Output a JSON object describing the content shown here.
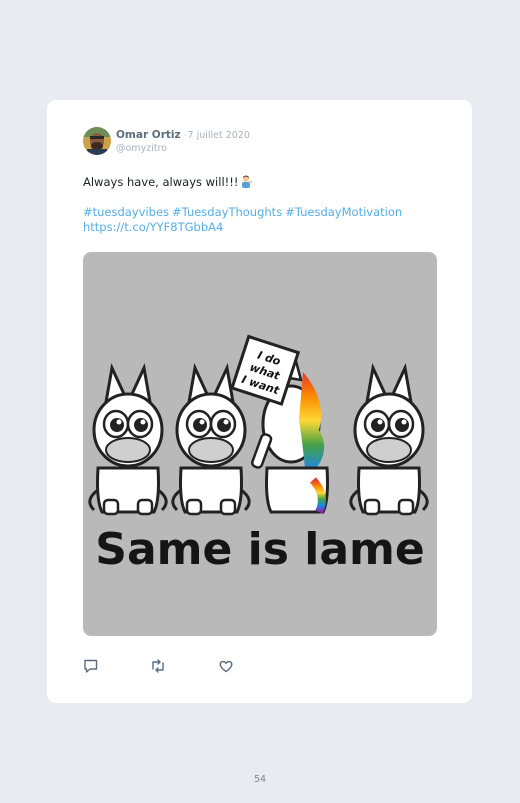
{
  "tweet": {
    "author_name": "Omar Ortiz",
    "separator": "·",
    "date": "7 juillet 2020",
    "handle": "@omyzitro",
    "text": "Always have, always will!!!",
    "hashtags": [
      "#tuesdayvibes",
      "#TuesdayThoughts",
      "#TuesdayMotivation"
    ],
    "link": "https://t.co/YYF8TGbbA4",
    "image": {
      "sign_text": [
        "I do",
        "what",
        "I want"
      ],
      "caption": "Same is lame"
    },
    "actions": [
      "reply-icon",
      "retweet-icon",
      "like-icon"
    ]
  },
  "page_number": "54",
  "colors": {
    "background": "#e8ebf0",
    "card": "#ffffff",
    "name": "#5b6c7d",
    "meta": "#a9b3bd",
    "link": "#55aee5",
    "image_bg": "#b9b9b9"
  }
}
